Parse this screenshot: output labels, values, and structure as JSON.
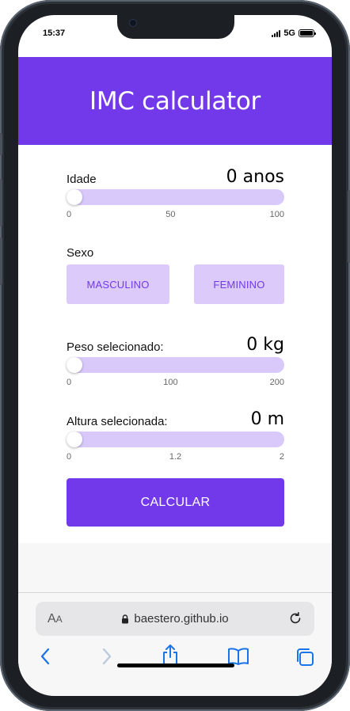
{
  "status": {
    "time": "15:37",
    "network": "5G"
  },
  "header": {
    "title": "IMC calculator"
  },
  "age": {
    "label": "Idade",
    "value": "0 anos",
    "min": "0",
    "mid": "50",
    "max": "100",
    "level": 0
  },
  "sex": {
    "label": "Sexo",
    "male": "MASCULINO",
    "female": "FEMININO"
  },
  "weight": {
    "label": "Peso selecionado:",
    "value": "0 kg",
    "min": "0",
    "mid": "100",
    "max": "200",
    "level": 0
  },
  "height": {
    "label": "Altura selecionada:",
    "value": "0 m",
    "min": "0",
    "mid": "1.2",
    "max": "2",
    "level": 0
  },
  "calculate": {
    "label": "CALCULAR"
  },
  "browser": {
    "text_size_large": "A",
    "text_size_small": "A",
    "url": "baestero.github.io"
  },
  "colors": {
    "primary": "#7239ea",
    "primary_light": "#dccafa",
    "track": "#d9c9fb",
    "ios_blue": "#1a73e8"
  }
}
